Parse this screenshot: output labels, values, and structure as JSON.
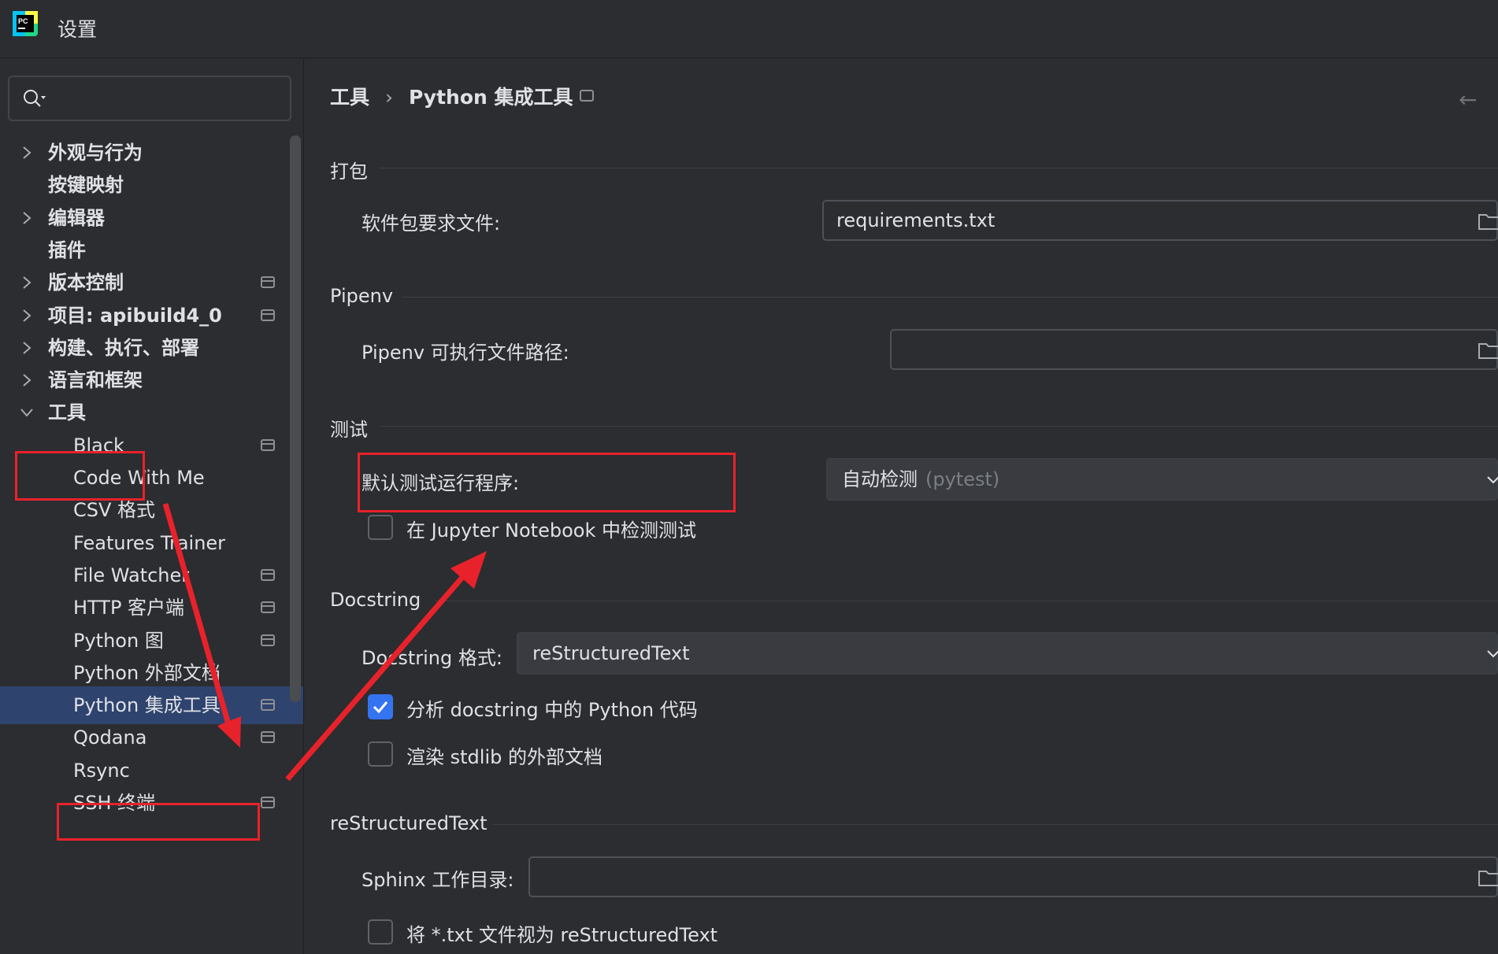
{
  "window": {
    "title": "设置",
    "app_icon": "pycharm-logo-icon"
  },
  "search": {
    "icon": "search-icon",
    "value": ""
  },
  "sidebar": {
    "items": [
      {
        "label": "外观与行为",
        "expandable": true,
        "expanded": false,
        "bold": true,
        "project_scoped": false
      },
      {
        "label": "按键映射",
        "expandable": false,
        "bold": true,
        "project_scoped": false
      },
      {
        "label": "编辑器",
        "expandable": true,
        "expanded": false,
        "bold": true,
        "project_scoped": false
      },
      {
        "label": "插件",
        "expandable": false,
        "bold": true,
        "project_scoped": false
      },
      {
        "label": "版本控制",
        "expandable": true,
        "expanded": false,
        "bold": true,
        "project_scoped": true
      },
      {
        "label": "项目: apibuild4_0",
        "expandable": true,
        "expanded": false,
        "bold": true,
        "project_scoped": true
      },
      {
        "label": "构建、执行、部署",
        "expandable": true,
        "expanded": false,
        "bold": true,
        "project_scoped": false
      },
      {
        "label": "语言和框架",
        "expandable": true,
        "expanded": false,
        "bold": true,
        "project_scoped": false
      },
      {
        "label": "工具",
        "expandable": true,
        "expanded": true,
        "bold": true,
        "project_scoped": false
      }
    ],
    "children": [
      {
        "label": "Black",
        "project_scoped": true
      },
      {
        "label": "Code With Me",
        "project_scoped": false
      },
      {
        "label": "CSV 格式",
        "project_scoped": false
      },
      {
        "label": "Features Trainer",
        "project_scoped": false
      },
      {
        "label": "File Watcher",
        "project_scoped": true
      },
      {
        "label": "HTTP 客户端",
        "project_scoped": true
      },
      {
        "label": "Python 图",
        "project_scoped": true
      },
      {
        "label": "Python 外部文档",
        "project_scoped": false
      },
      {
        "label": "Python 集成工具",
        "project_scoped": true,
        "selected": true
      },
      {
        "label": "Qodana",
        "project_scoped": true
      },
      {
        "label": "Rsync",
        "project_scoped": false
      },
      {
        "label": "SSH 终端",
        "project_scoped": true
      }
    ]
  },
  "breadcrumb": {
    "parent": "工具",
    "separator": "›",
    "current": "Python 集成工具"
  },
  "sections": {
    "packaging": {
      "title": "打包",
      "requirements_label": "软件包要求文件:",
      "requirements_value": "requirements.txt"
    },
    "pipenv": {
      "title": "Pipenv",
      "path_label": "Pipenv 可执行文件路径:",
      "path_value": ""
    },
    "testing": {
      "title": "测试",
      "runner_label": "默认测试运行程序:",
      "runner_value": "自动检测",
      "runner_hint": "(pytest)",
      "jupyter_label": "在 Jupyter Notebook 中检测测试",
      "jupyter_checked": false
    },
    "docstring": {
      "title": "Docstring",
      "format_label": "Docstring 格式:",
      "format_value": "reStructuredText",
      "analyze_label": "分析 docstring 中的 Python 代码",
      "analyze_checked": true,
      "render_label": "渲染 stdlib 的外部文档",
      "render_checked": false
    },
    "restructured": {
      "title": "reStructuredText",
      "sphinx_label": "Sphinx 工作目录:",
      "sphinx_value": "",
      "txt_label": "将 *.txt 文件视为 reStructuredText",
      "txt_checked": false
    }
  },
  "colors": {
    "background": "#2b2d30",
    "selection": "#2e436e",
    "accent": "#3574f0",
    "annotation_red": "#e8222b"
  }
}
